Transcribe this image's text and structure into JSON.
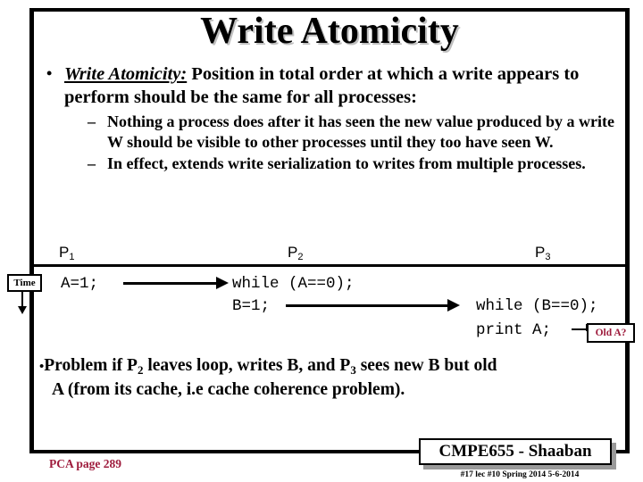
{
  "slide": {
    "title": "Write Atomicity",
    "main_bullet": {
      "bullet_glyph": "•",
      "lead": "Write Atomicity:",
      "text": " Position in total order at which a write appears to perform should be the same for all processes:"
    },
    "sub_bullets": [
      {
        "dash": "–",
        "text": "Nothing a process does after it has seen the new value produced by a write W should be visible to other processes until they too have seen W."
      },
      {
        "dash": "–",
        "text": "In effect, extends write serialization to writes from multiple processes."
      }
    ],
    "diagram": {
      "process_labels": [
        {
          "name": "P",
          "sub": "1"
        },
        {
          "name": "P",
          "sub": "2"
        },
        {
          "name": "P",
          "sub": "3"
        }
      ],
      "time_label": "Time",
      "code": {
        "p1_write": "A=1;",
        "p2_while": "while (A==0);",
        "p2_write": "B=1;",
        "p3_while": "while (B==0);",
        "p3_print": "print A;"
      },
      "callout": "Old A?",
      "callout_color": "#9e1b3c"
    },
    "problem": {
      "bullet_glyph": "•",
      "line1_a": "Problem if P",
      "line1_sub1": "2",
      "line1_b": " leaves loop, writes B, and P",
      "line1_sub2": "3",
      "line1_c": " sees new B but old",
      "line2": "A  (from its cache, i.e cache coherence problem)."
    },
    "footer": {
      "source_ref": "PCA page 289",
      "source_ref_color": "#9e1b3c",
      "course_box": "CMPE655 - Shaaban",
      "course_sub": "#17   lec #10   Spring 2014   5-6-2014"
    }
  }
}
